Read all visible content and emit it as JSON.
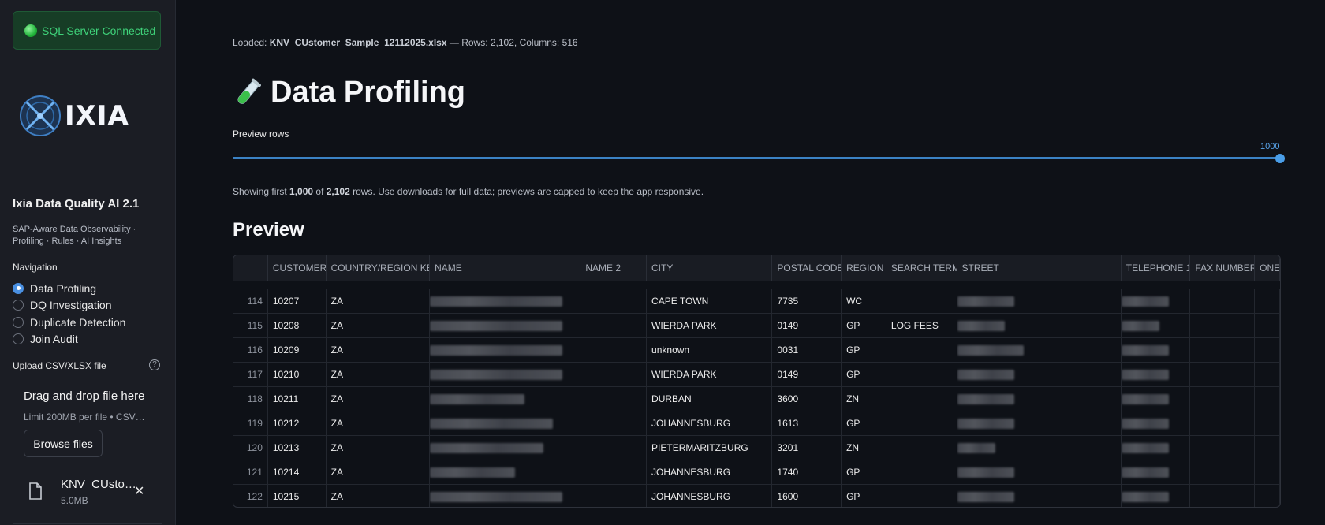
{
  "sidebar": {
    "connection_status": "SQL Server Connected",
    "logo_text": "IXIA",
    "app_title": "Ixia Data Quality AI 2.1",
    "app_subtitle": "SAP-Aware Data Observability · Profiling · Rules · AI Insights",
    "navigation_label": "Navigation",
    "nav_items": [
      {
        "label": "Data Profiling",
        "selected": true
      },
      {
        "label": "DQ Investigation",
        "selected": false
      },
      {
        "label": "Duplicate Detection",
        "selected": false
      },
      {
        "label": "Join Audit",
        "selected": false
      }
    ],
    "upload_label": "Upload CSV/XLSX file",
    "help_glyph": "?",
    "dropzone": {
      "title": "Drag and drop file here",
      "limit": "Limit 200MB per file • CSV…",
      "browse_label": "Browse files"
    },
    "uploaded_file": {
      "name": "KNV_CUsto…",
      "size": "5.0MB",
      "remove_glyph": "✕"
    }
  },
  "main": {
    "loaded_prefix": "Loaded: ",
    "loaded_file": "KNV_CUstomer_Sample_12112025.xlsx",
    "loaded_suffix": " — Rows: 2,102, Columns: 516",
    "page_title": "Data Profiling",
    "preview_rows_label": "Preview rows",
    "preview_rows_value": "1000",
    "preview_rows_fraction": 1.0,
    "showing_prefix": "Showing first ",
    "showing_count": "1,000",
    "showing_mid": " of ",
    "showing_total": "2,102",
    "showing_suffix": " rows. Use downloads for full data; previews are capped to keep the app responsive.",
    "section_title": "Preview"
  },
  "table": {
    "columns": [
      "",
      "CUSTOMER",
      "COUNTRY/REGION KEY",
      "NAME",
      "NAME 2",
      "CITY",
      "POSTAL CODE",
      "REGION",
      "SEARCH TERM",
      "STREET",
      "TELEPHONE 1",
      "FAX NUMBER",
      "ONE-"
    ],
    "rows": [
      {
        "idx": "114",
        "customer": "10207",
        "country": "ZA",
        "city": "CAPE TOWN",
        "postal": "7735",
        "region": "WC",
        "search": ""
      },
      {
        "idx": "115",
        "customer": "10208",
        "country": "ZA",
        "city": "WIERDA PARK",
        "postal": "0149",
        "region": "GP",
        "search": "LOG FEES"
      },
      {
        "idx": "116",
        "customer": "10209",
        "country": "ZA",
        "city": "unknown",
        "postal": "0031",
        "region": "GP",
        "search": ""
      },
      {
        "idx": "117",
        "customer": "10210",
        "country": "ZA",
        "city": "WIERDA PARK",
        "postal": "0149",
        "region": "GP",
        "search": ""
      },
      {
        "idx": "118",
        "customer": "10211",
        "country": "ZA",
        "city": "DURBAN",
        "postal": "3600",
        "region": "ZN",
        "search": ""
      },
      {
        "idx": "119",
        "customer": "10212",
        "country": "ZA",
        "city": "JOHANNESBURG",
        "postal": "1613",
        "region": "GP",
        "search": ""
      },
      {
        "idx": "120",
        "customer": "10213",
        "country": "ZA",
        "city": "PIETERMARITZBURG",
        "postal": "3201",
        "region": "ZN",
        "search": ""
      },
      {
        "idx": "121",
        "customer": "10214",
        "country": "ZA",
        "city": "JOHANNESBURG",
        "postal": "1740",
        "region": "GP",
        "search": ""
      },
      {
        "idx": "122",
        "customer": "10215",
        "country": "ZA",
        "city": "JOHANNESBURG",
        "postal": "1600",
        "region": "GP",
        "search": ""
      }
    ]
  },
  "colors": {
    "background": "#0e1117",
    "sidebar": "#1b1d24",
    "accent": "#4a9ee8",
    "success": "#3fd37a"
  }
}
